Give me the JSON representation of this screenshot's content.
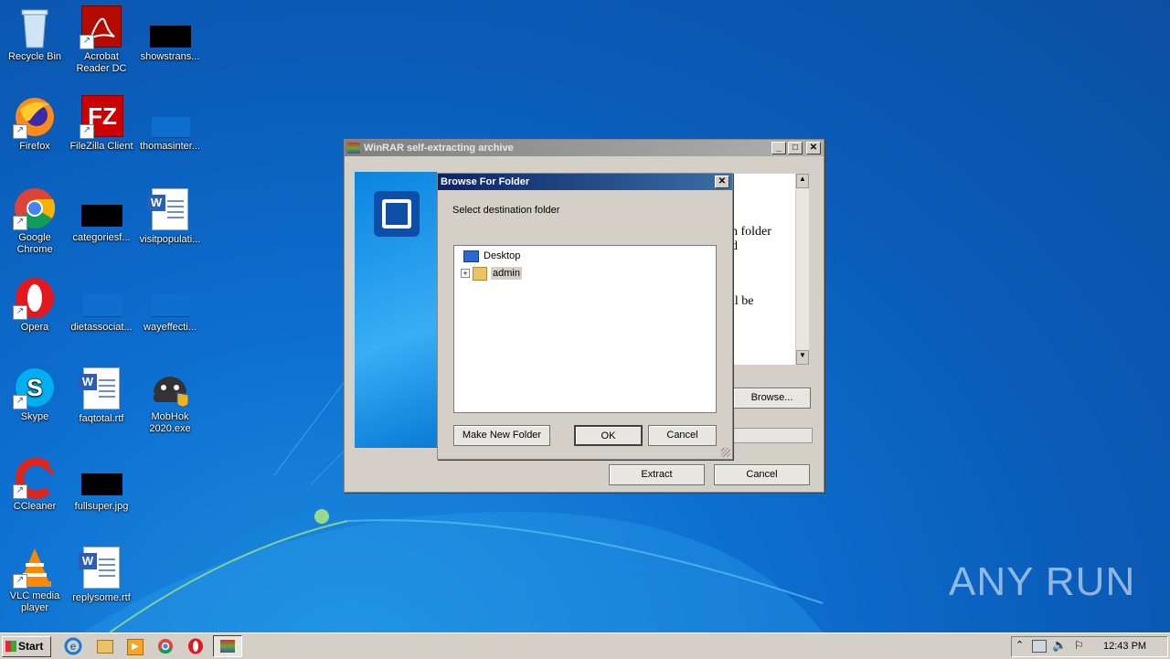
{
  "desktop": {
    "icons": [
      {
        "label": "Recycle Bin",
        "icon": "recycle-bin-icon"
      },
      {
        "label": "Acrobat Reader DC",
        "icon": "acrobat-icon"
      },
      {
        "label": "showstrans...",
        "icon": "black-thumbnail-icon"
      },
      {
        "label": "Firefox",
        "icon": "firefox-icon"
      },
      {
        "label": "FileZilla Client",
        "icon": "filezilla-icon"
      },
      {
        "label": "thomasinter...",
        "icon": "folder-icon"
      },
      {
        "label": "Google Chrome",
        "icon": "chrome-icon"
      },
      {
        "label": "categoriesf...",
        "icon": "black-thumbnail-icon"
      },
      {
        "label": "visitpopulati...",
        "icon": "word-document-icon"
      },
      {
        "label": "Opera",
        "icon": "opera-icon"
      },
      {
        "label": "dietassociat...",
        "icon": "folder-icon"
      },
      {
        "label": "wayeffecti...",
        "icon": "folder-icon"
      },
      {
        "label": "Skype",
        "icon": "skype-icon"
      },
      {
        "label": "faqtotal.rtf",
        "icon": "word-document-icon"
      },
      {
        "label": "MobHok 2020.exe",
        "icon": "android-exe-icon"
      },
      {
        "label": "CCleaner",
        "icon": "ccleaner-icon"
      },
      {
        "label": "fullsuper.jpg",
        "icon": "black-thumbnail-icon"
      },
      {
        "label": "VLC media player",
        "icon": "vlc-icon"
      },
      {
        "label": "replysome.rtf",
        "icon": "word-document-icon"
      }
    ],
    "watermark": "ANY RUN"
  },
  "winrar": {
    "title": "WinRAR self-extracting archive",
    "text_fragment_1": "n folder",
    "text_fragment_2": "d",
    "text_fragment_3": "ll be",
    "browse_label": "Browse...",
    "extract_label": "Extract",
    "cancel_label": "Cancel",
    "colors": {
      "accent": "#0a84e0"
    }
  },
  "browse_dialog": {
    "title": "Browse For Folder",
    "prompt": "Select destination folder",
    "tree": [
      {
        "label": "Desktop",
        "icon": "desktop-icon"
      },
      {
        "label": "admin",
        "icon": "user-folder-icon",
        "expander": "+"
      }
    ],
    "make_new_folder_label": "Make New Folder",
    "ok_label": "OK",
    "cancel_label": "Cancel"
  },
  "taskbar": {
    "start_label": "Start",
    "clock": "12:43 PM"
  }
}
